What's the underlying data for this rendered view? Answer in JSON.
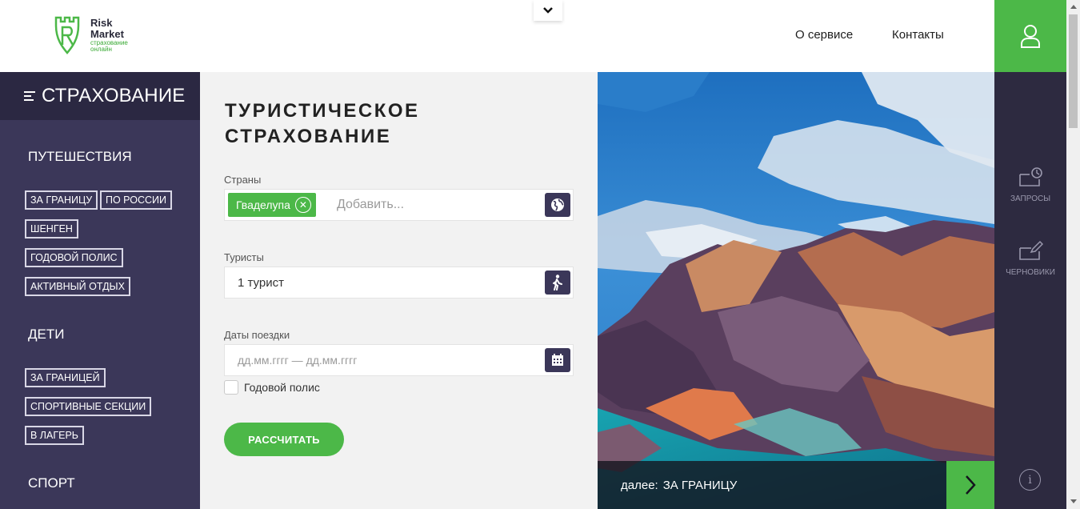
{
  "header": {
    "logo": {
      "name": "Risk Market",
      "line1": "Risk",
      "line2": "Market",
      "tagline1": "страхование",
      "tagline2": "онлайн"
    },
    "nav": {
      "about": "О сервисе",
      "contacts": "Контакты"
    }
  },
  "sidebar": {
    "title": "СТРАХОВАНИЕ",
    "sections": [
      {
        "title": "ПУТЕШЕСТВИЯ",
        "tags": [
          "ЗА ГРАНИЦУ",
          "ПО РОССИИ",
          "ШЕНГЕН",
          "ГОДОВОЙ ПОЛИС",
          "АКТИВНЫЙ ОТДЫХ"
        ]
      },
      {
        "title": "ДЕТИ",
        "tags": [
          "ЗА ГРАНИЦЕЙ",
          "СПОРТИВНЫЕ СЕКЦИИ",
          "В ЛАГЕРЬ"
        ]
      },
      {
        "title": "СПОРТ",
        "tags": []
      }
    ]
  },
  "form": {
    "title": "ТУРИСТИЧЕСКОЕ СТРАХОВАНИЕ",
    "countries": {
      "label": "Страны",
      "selected": "Гваделупа",
      "placeholder": "Добавить..."
    },
    "tourists": {
      "label": "Туристы",
      "value": "1 турист"
    },
    "dates": {
      "label": "Даты поездки",
      "placeholder": "дд.мм.гггг — дд.мм.гггг"
    },
    "annual_policy": {
      "label": "Годовой полис",
      "checked": false
    },
    "submit": "РАССЧИТАТЬ"
  },
  "hero": {
    "next_prefix": "далее:",
    "next_target": "ЗА ГРАНИЦУ"
  },
  "rail": {
    "requests": "ЗАПРОСЫ",
    "drafts": "ЧЕРНОВИКИ",
    "info": "i"
  },
  "colors": {
    "accent": "#4cb848",
    "sidebar": "#3b3759",
    "sidebar_dark": "#2b2842",
    "rail": "#2d2a40"
  },
  "icons": [
    "chevron-down-icon",
    "user-icon",
    "menu-icon",
    "globe-icon",
    "walking-person-icon",
    "calendar-icon",
    "remove-icon",
    "requests-icon",
    "drafts-icon",
    "info-icon",
    "arrow-right-icon"
  ]
}
